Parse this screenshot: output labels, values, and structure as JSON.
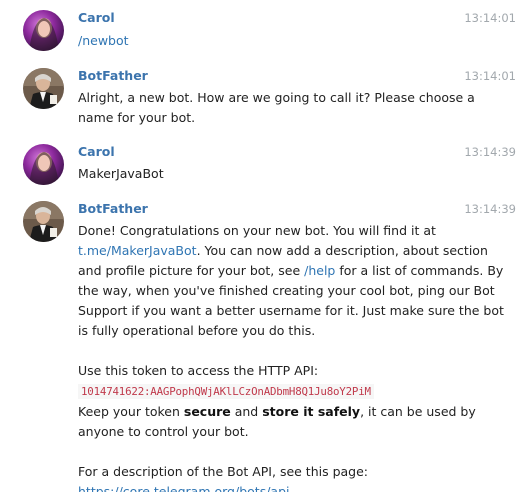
{
  "messages": [
    {
      "sender": "Carol",
      "time": "13:14:01",
      "avatar": "carol-avatar",
      "text": "/newbot"
    },
    {
      "sender": "BotFather",
      "time": "13:14:01",
      "avatar": "botfather-avatar",
      "line1": "Alright, a new bot. How are we going to call it? Please choose a",
      "line2": "name for your bot."
    },
    {
      "sender": "Carol",
      "time": "13:14:39",
      "avatar": "carol-avatar",
      "text": "MakerJavaBot"
    },
    {
      "sender": "BotFather",
      "time": "13:14:39",
      "avatar": "botfather-avatar",
      "l1": "Done! Congratulations on your new bot. You will find it at",
      "link_bot": "t.me/MakerJavaBot",
      "l2_rest": ". You can now add a description, about section",
      "l3_a": "and profile picture for your bot, see ",
      "cmd_help": "/help",
      "l3_b": " for a list of commands. By",
      "l4": "the way, when you've finished creating your cool bot, ping our Bot",
      "l5": "Support if you want a better username for it. Just make sure the bot",
      "l6": "is fully operational before you do this.",
      "token_intro": "Use this token to access the HTTP API:",
      "token": "1014741622:AAGPophQWjAKlLCzOnADbmH8Q1Ju8oY2PiM",
      "keep_a": "Keep your token ",
      "keep_secure": "secure",
      "keep_and": " and ",
      "keep_store": "store it safely",
      "keep_b": ", it can be used by",
      "keep_c": "anyone to control your bot.",
      "api_intro": "For a description of the Bot API, see this page:",
      "api_link": "https://core.telegram.org/bots/api"
    }
  ],
  "colors": {
    "sender": "#3c74ad",
    "link": "#2f75b3",
    "token": "#c0394b",
    "time": "#a2a8ad"
  }
}
